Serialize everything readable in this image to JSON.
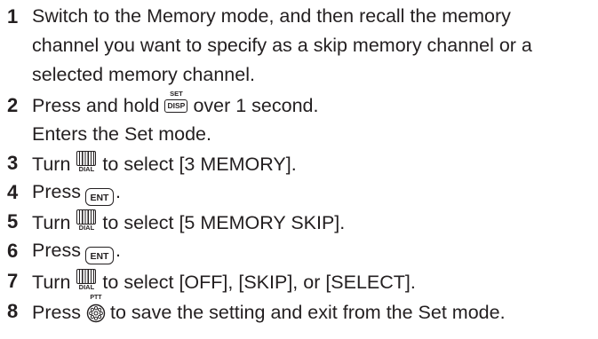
{
  "steps": [
    {
      "number": "1",
      "lines": [
        "Switch to the Memory mode, and then recall the memory",
        "channel you want to specify as a skip memory channel or a",
        "selected memory channel."
      ]
    },
    {
      "number": "2",
      "before": "Press and hold",
      "key_top": "SET",
      "key": "DISP",
      "after": "over 1 second.",
      "note": "Enters the Set mode."
    },
    {
      "number": "3",
      "before": "Turn",
      "key": "DIAL",
      "after": "to select [3 MEMORY]."
    },
    {
      "number": "4",
      "before": "Press",
      "key": "ENT",
      "after": "."
    },
    {
      "number": "5",
      "before": "Turn",
      "key": "DIAL",
      "after": "to select [5 MEMORY SKIP]."
    },
    {
      "number": "6",
      "before": "Press",
      "key": "ENT",
      "after": "."
    },
    {
      "number": "7",
      "before": "Turn",
      "key": "DIAL",
      "after": "to select [OFF], [SKIP], or [SELECT]."
    },
    {
      "number": "8",
      "before": "Press",
      "key": "PTT",
      "after": "to save the setting and exit from the Set mode."
    }
  ],
  "icons": {
    "disp": "disp-key-icon",
    "dial": "dial-icon",
    "ent": "ent-key-icon",
    "ptt": "ptt-icon"
  },
  "colors": {
    "text": "#231f20",
    "background": "#ffffff"
  }
}
